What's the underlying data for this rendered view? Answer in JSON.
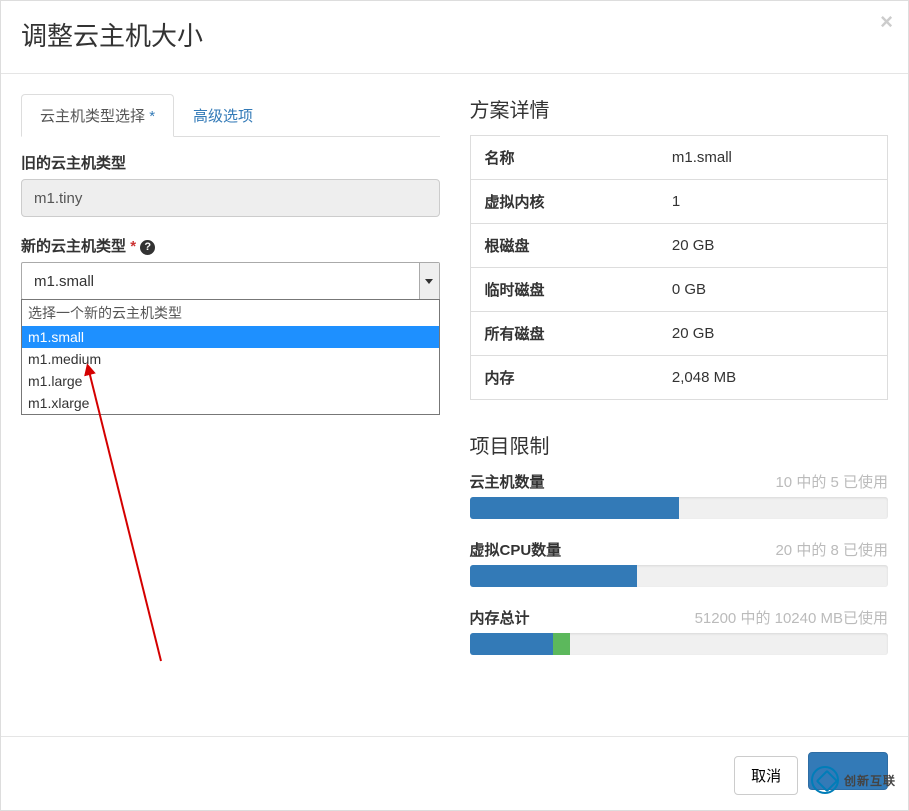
{
  "modal_title": "调整云主机大小",
  "tabs": {
    "flavor": "云主机类型选择",
    "advanced": "高级选项"
  },
  "form": {
    "old_flavor_label": "旧的云主机类型",
    "old_flavor_value": "m1.tiny",
    "new_flavor_label": "新的云主机类型",
    "new_flavor_selected": "m1.small",
    "dropdown_group_label": "选择一个新的云主机类型",
    "dropdown_options": [
      "m1.small",
      "m1.medium",
      "m1.large",
      "m1.xlarge"
    ]
  },
  "details": {
    "section_title": "方案详情",
    "rows": [
      {
        "label": "名称",
        "value": "m1.small"
      },
      {
        "label": "虚拟内核",
        "value": "1"
      },
      {
        "label": "根磁盘",
        "value": "20 GB"
      },
      {
        "label": "临时磁盘",
        "value": "0 GB"
      },
      {
        "label": "所有磁盘",
        "value": "20 GB"
      },
      {
        "label": "内存",
        "value": "2,048 MB"
      }
    ]
  },
  "limits": {
    "section_title": "项目限制",
    "instances": {
      "label": "云主机数量",
      "usage_text": "10 中的 5 已使用",
      "percent": 50,
      "added": 0
    },
    "vcpus": {
      "label": "虚拟CPU数量",
      "usage_text": "20 中的 8 已使用",
      "percent": 40,
      "added": 0
    },
    "ram": {
      "label": "内存总计",
      "usage_text": "51200 中的 10240 MB已使用",
      "percent": 20,
      "added": 4
    }
  },
  "footer": {
    "cancel": "取消",
    "submit": ""
  },
  "watermark": "创新互联"
}
